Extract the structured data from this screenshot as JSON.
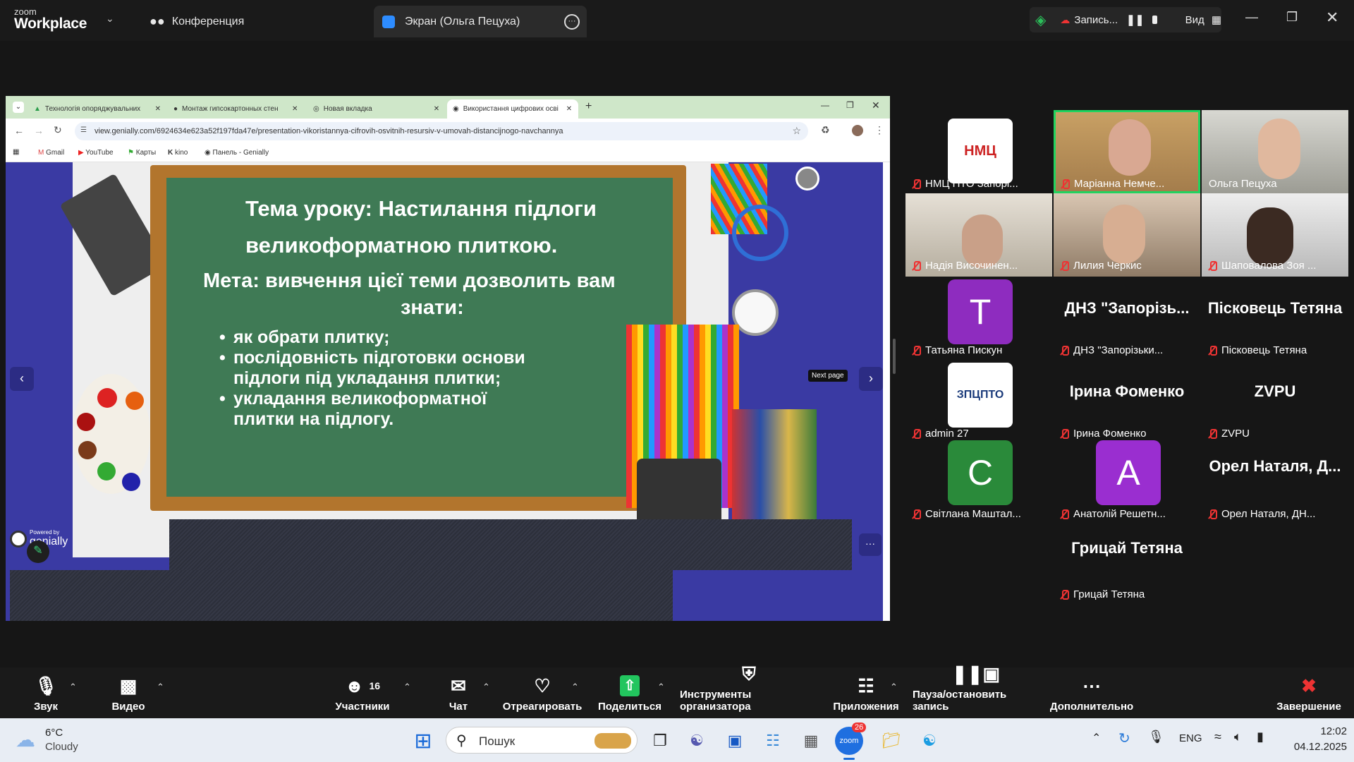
{
  "zoom": {
    "brand_small": "zoom",
    "brand_big": "Workplace",
    "tab_conference": "Конференция",
    "tab_screen": "Экран (Ольга Пецуха)",
    "record_label": "Запись...",
    "view_label": "Вид"
  },
  "browser": {
    "tabs": [
      {
        "label": "Технологія опоряджувальних"
      },
      {
        "label": "Монтаж гипсокартонных стен"
      },
      {
        "label": "Новая вкладка"
      },
      {
        "label": "Використання цифрових осві"
      }
    ],
    "url": "view.genially.com/6924634e623a52f197fda47e/presentation-vikoristannya-cifrovih-osvitnih-resursiv-v-umovah-distancijnogo-navchannya",
    "bookmarks": [
      "Gmail",
      "YouTube",
      "Карты",
      "kino",
      "Панель - Genially"
    ]
  },
  "slide": {
    "title_line1": "Тема уроку: Настилання підлоги",
    "title_line2": "великоформатною плиткою.",
    "goal_line1": "Мета: вивчення цієї теми дозволить вам",
    "goal_line2": "знати:",
    "bullets": [
      "як обрати плитку;",
      "послідовність підготовки основи підлоги під укладання плитки;",
      "укладання великоформатної плитки на підлогу."
    ],
    "tooltip": "Next page",
    "powered": "Powered by",
    "genially": "genially"
  },
  "participants": [
    {
      "name": "НМЦ ПТО Запорі...",
      "tile_text": "НМЦ ПТО"
    },
    {
      "name": "Маріанна Немче..."
    },
    {
      "name": "Ольга Пецуха"
    },
    {
      "name": "Надія Височинен..."
    },
    {
      "name": "Лилия Черкис"
    },
    {
      "name": "Шаповалова Зоя ..."
    },
    {
      "name": "Татьяна Пискун",
      "avatar": "T"
    },
    {
      "name": "ДНЗ \"Запорізьки...",
      "big": "ДНЗ \"Запорізь..."
    },
    {
      "name": "Пісковець Тетяна",
      "big": "Пісковець Тетяна"
    },
    {
      "name": "admin 27",
      "tile_text": "ЗПЦПТО"
    },
    {
      "name": "Ірина Фоменко",
      "big": "Ірина Фоменко"
    },
    {
      "name": "ZVPU",
      "big": "ZVPU"
    },
    {
      "name": "Світлана Маштал...",
      "avatar": "C"
    },
    {
      "name": "Анатолій Решетн...",
      "avatar": "A"
    },
    {
      "name": "Орел Наталя, ДН...",
      "big": "Орел Наталя, Д..."
    },
    {
      "name": "Грицай Тетяна",
      "big": "Грицай Тетяна"
    }
  ],
  "toolbar": {
    "audio": "Звук",
    "video": "Видео",
    "participants": "Участники",
    "participants_count": "16",
    "chat": "Чат",
    "react": "Отреагировать",
    "share": "Поделиться",
    "host_tools": "Инструменты организатора",
    "apps": "Приложения",
    "pause_record": "Пауза/остановить запись",
    "more": "Дополнительно",
    "end": "Завершение"
  },
  "taskbar": {
    "temp": "6°C",
    "weather": "Cloudy",
    "search": "Пошук",
    "lang": "ENG",
    "time": "12:02",
    "date": "04.12.2025",
    "zoom_badge": "26"
  }
}
